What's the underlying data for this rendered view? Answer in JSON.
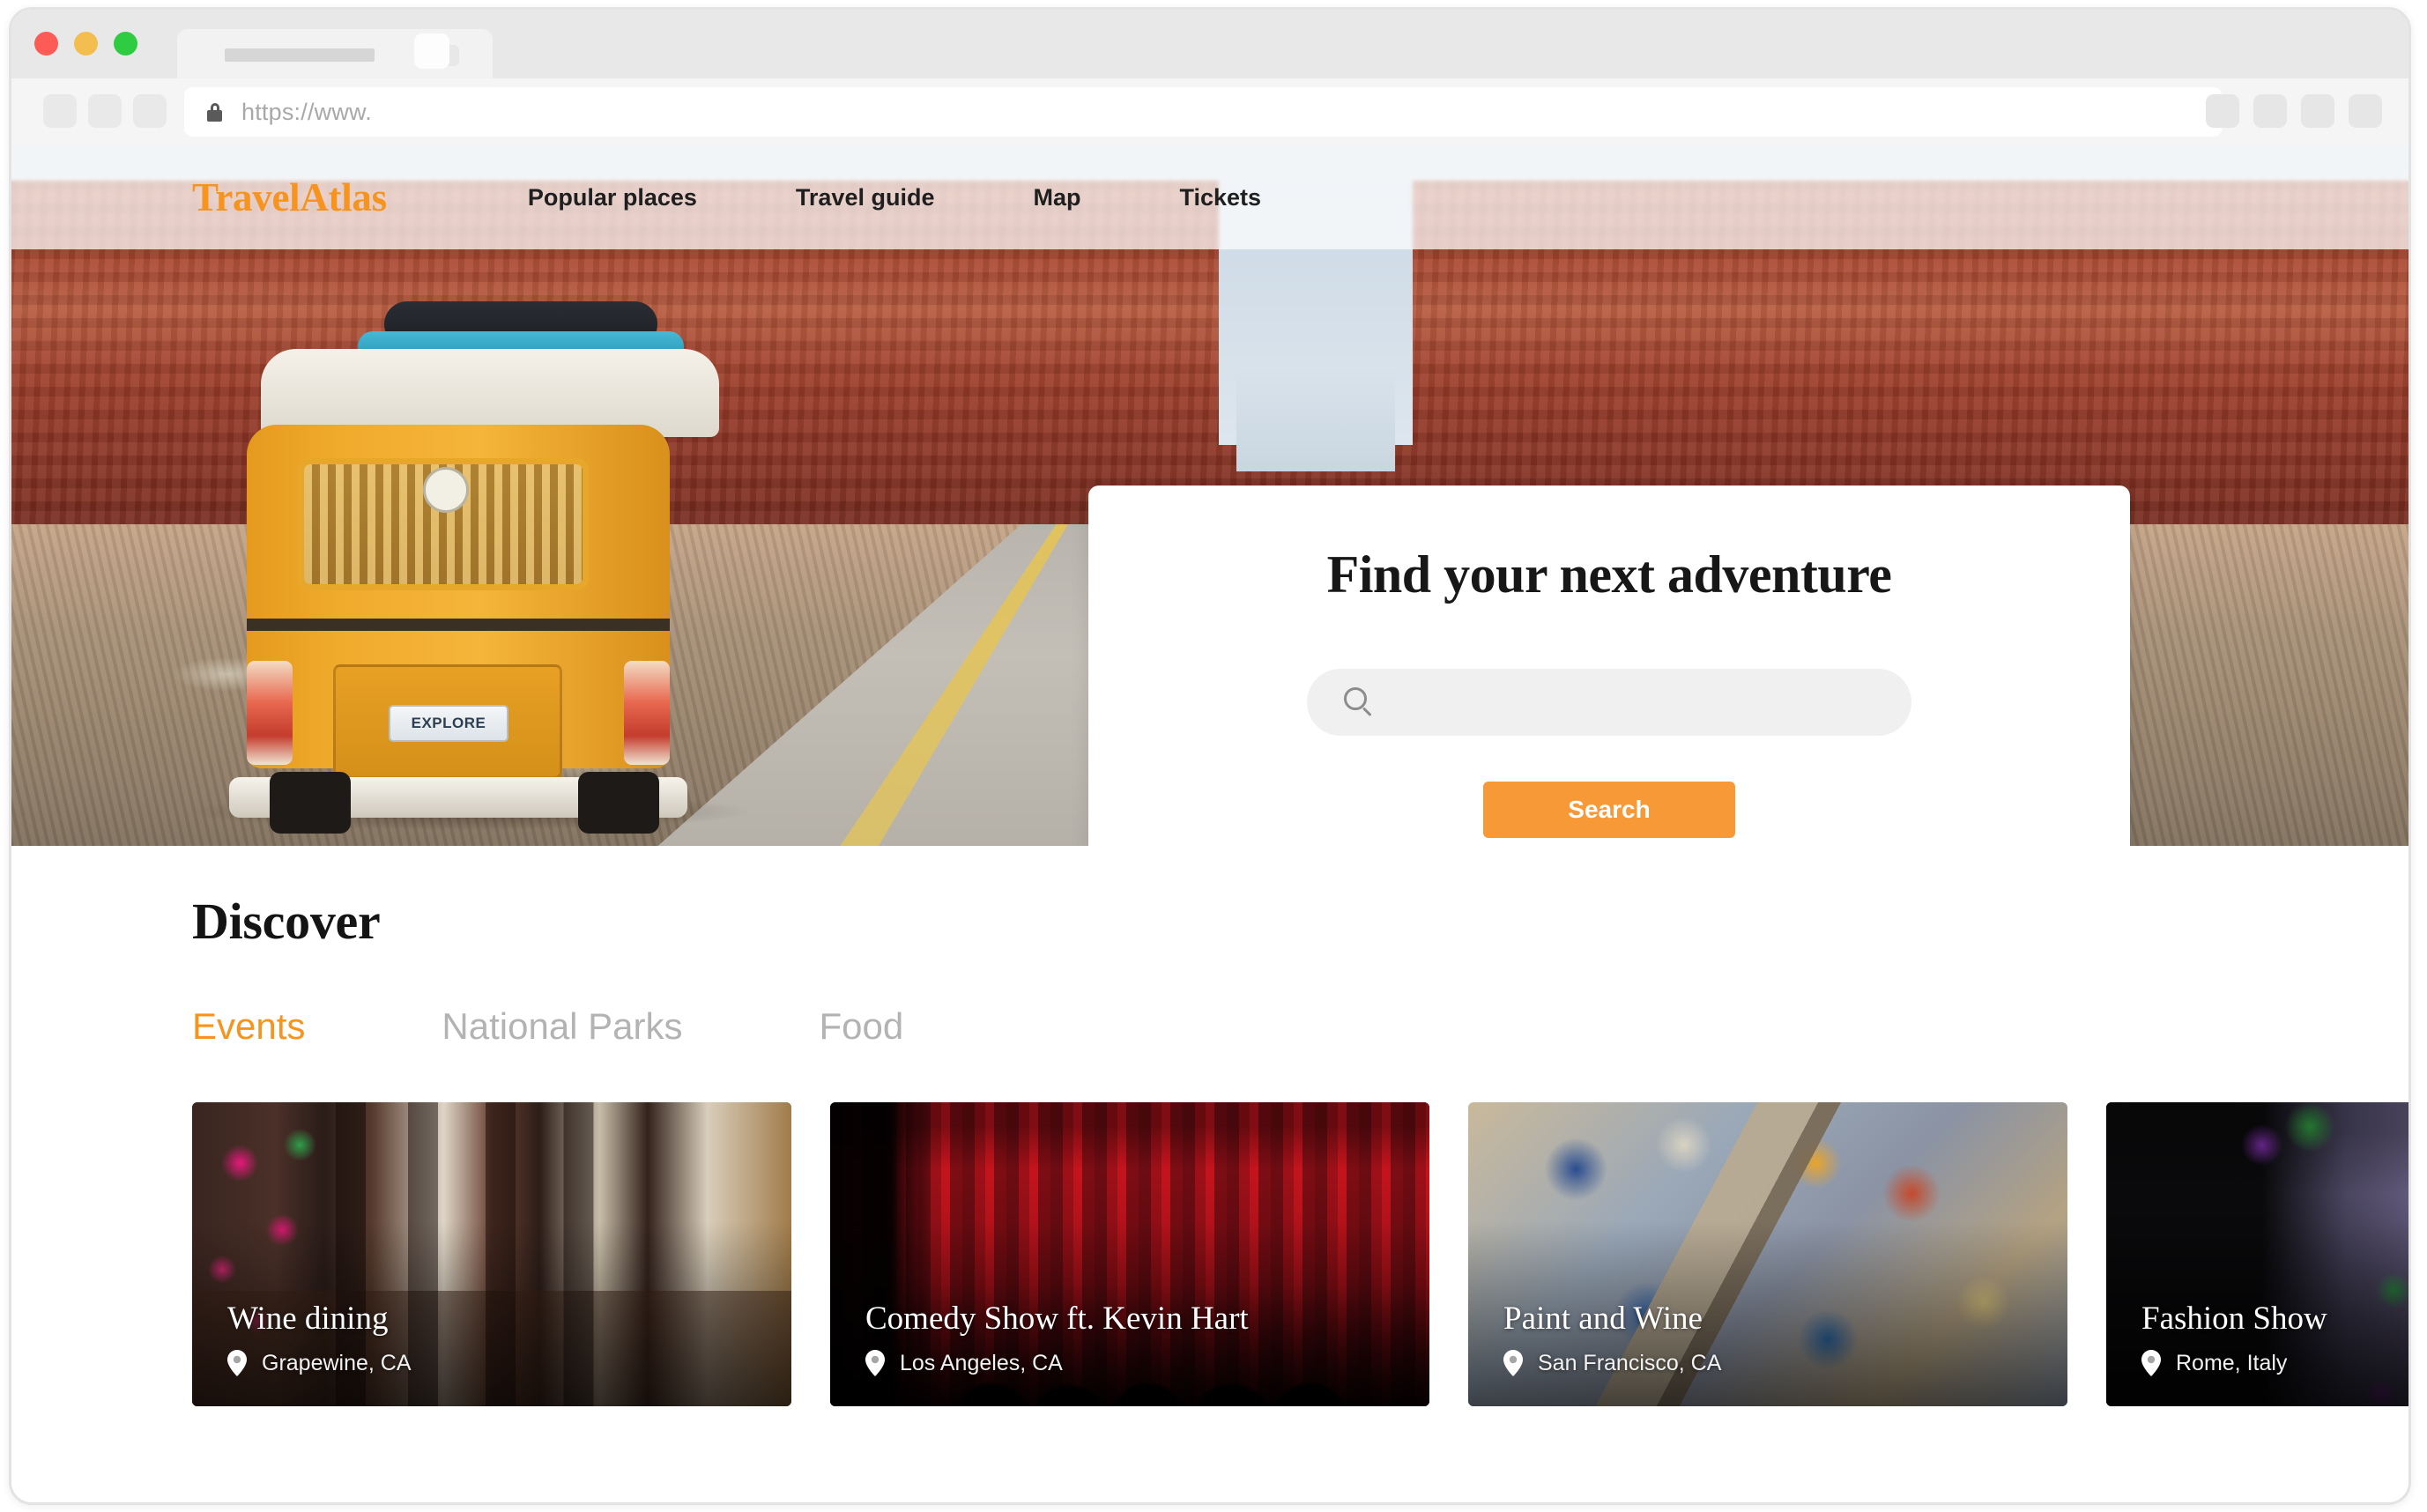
{
  "browser": {
    "url_text": "https://www.",
    "lock_icon": "lock-icon",
    "traffic_lights": [
      "close-red",
      "minimize-yellow",
      "maximize-green"
    ],
    "nav_buttons": [
      "back-button",
      "forward-button",
      "reload-button"
    ],
    "toolbar_buttons": [
      "extension-button-1",
      "extension-button-2",
      "extension-button-3",
      "menu-button"
    ],
    "tab": {
      "title": "",
      "close_icon": "close-icon"
    },
    "new_tab_label": "new-tab-button"
  },
  "site": {
    "brand": "TravelAtlas",
    "brand_color": "#f7941e",
    "nav": [
      {
        "label": "Popular places"
      },
      {
        "label": "Travel guide"
      },
      {
        "label": "Map"
      },
      {
        "label": "Tickets"
      }
    ]
  },
  "hero": {
    "search_card": {
      "title": "Find your next adventure",
      "input_value": "",
      "input_placeholder": "",
      "search_icon": "search-icon",
      "button_label": "Search",
      "button_color": "#f89938"
    },
    "image_alt": "Yellow vintage camper van driving on a desert road beside red rock cliffs",
    "license_plate": "EXPLORE"
  },
  "discover": {
    "heading": "Discover",
    "tabs": [
      {
        "label": "Events",
        "active": true
      },
      {
        "label": "National Parks",
        "active": false
      },
      {
        "label": "Food",
        "active": false
      }
    ],
    "active_tab_color": "#f7941e",
    "inactive_tab_color": "#b3b3b3",
    "cards": [
      {
        "title": "Wine dining",
        "location": "Grapewine, CA",
        "pin_icon": "location-pin-icon"
      },
      {
        "title": "Comedy Show ft. Kevin Hart",
        "location": "Los Angeles, CA",
        "pin_icon": "location-pin-icon"
      },
      {
        "title": "Paint and Wine",
        "location": "San Francisco, CA",
        "pin_icon": "location-pin-icon"
      },
      {
        "title": "Fashion Show",
        "location": "Rome, Italy",
        "pin_icon": "location-pin-icon"
      }
    ]
  }
}
